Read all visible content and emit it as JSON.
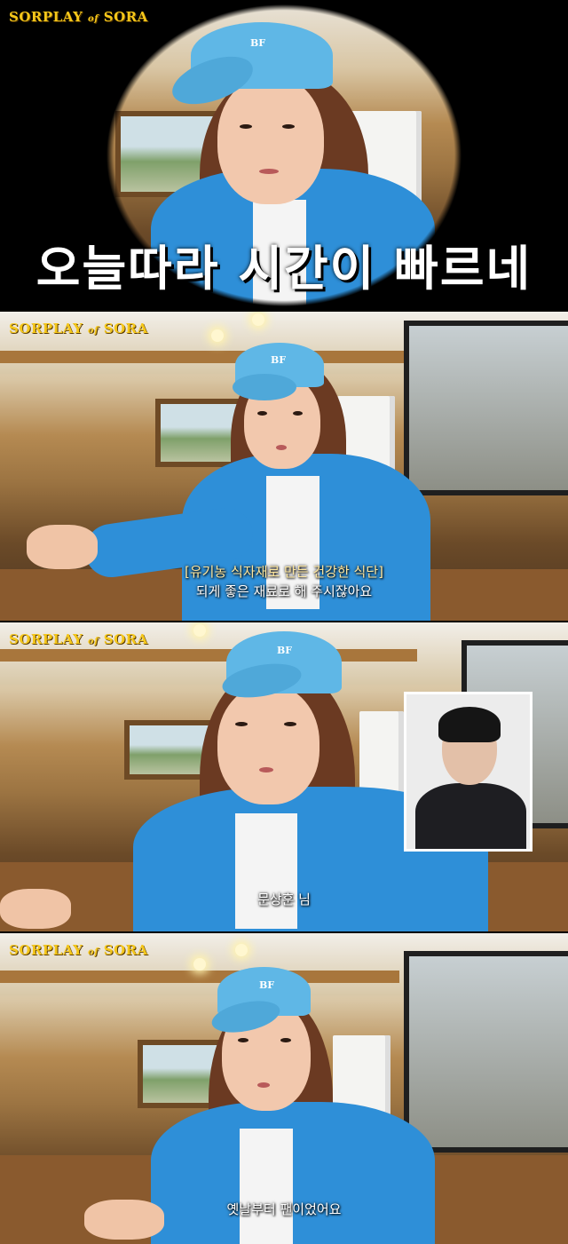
{
  "channel_logo": {
    "main": "SORPLAY",
    "of": "of",
    "end": "SORA"
  },
  "panels": [
    {
      "big_caption": "오늘따라 시간이 빠르네"
    },
    {
      "topic": "[유기농 식자재로 만든 건강한 식단]",
      "caption": "되게 좋은 재료로 해 주시잖아요"
    },
    {
      "caption": "문상훈 님"
    },
    {
      "caption": "옛날부터 팬이었어요"
    }
  ],
  "cap_text": "BF",
  "colors": {
    "logo": "#f5c71a",
    "cardigan": "#2e8fd8",
    "cap": "#5fb7e6"
  }
}
